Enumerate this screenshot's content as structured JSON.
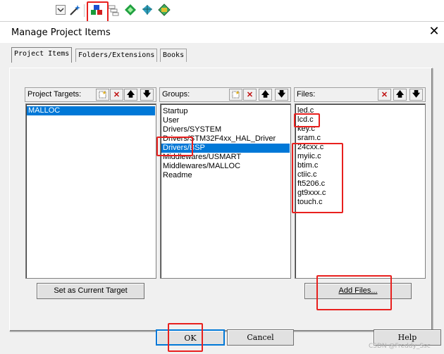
{
  "toolbar": {
    "icons": [
      "dropdown-arrow-icon",
      "magic-wand-icon",
      "manage-project-items-icon",
      "component-stack-icon",
      "diamond-green-icon",
      "diamond-blue-icon",
      "pack-installer-icon"
    ]
  },
  "dialog": {
    "title": "Manage Project Items",
    "close_glyph": "✕",
    "tabs": [
      {
        "label": "Project Items",
        "active": true
      },
      {
        "label": "Folders/Extensions",
        "active": false
      },
      {
        "label": "Books",
        "active": false
      }
    ],
    "targets": {
      "label": "Project Targets:",
      "items": [
        "MALLOC"
      ],
      "selected_index": 0,
      "set_current_button": "Set as Current Target"
    },
    "groups": {
      "label": "Groups:",
      "items": [
        "Startup",
        "User",
        "Drivers/SYSTEM",
        "Drivers/STM32F4xx_HAL_Driver",
        "Drivers/BSP",
        "Middlewares/USMART",
        "Middlewares/MALLOC",
        "Readme"
      ],
      "selected_index": 4
    },
    "files": {
      "label": "Files:",
      "items": [
        "led.c",
        "lcd.c",
        "key.c",
        "sram.c",
        "24cxx.c",
        "myiic.c",
        "btim.c",
        "ctiic.c",
        "ft5206.c",
        "gt9xxx.c",
        "touch.c"
      ],
      "add_button": "Add Files..."
    },
    "footer": {
      "ok": "OK",
      "cancel": "Cancel",
      "help": "Help"
    },
    "watermark": "CSDN @Freddy_Ssc"
  },
  "colors": {
    "selection": "#0078d7",
    "highlight_box": "#e8201e"
  }
}
